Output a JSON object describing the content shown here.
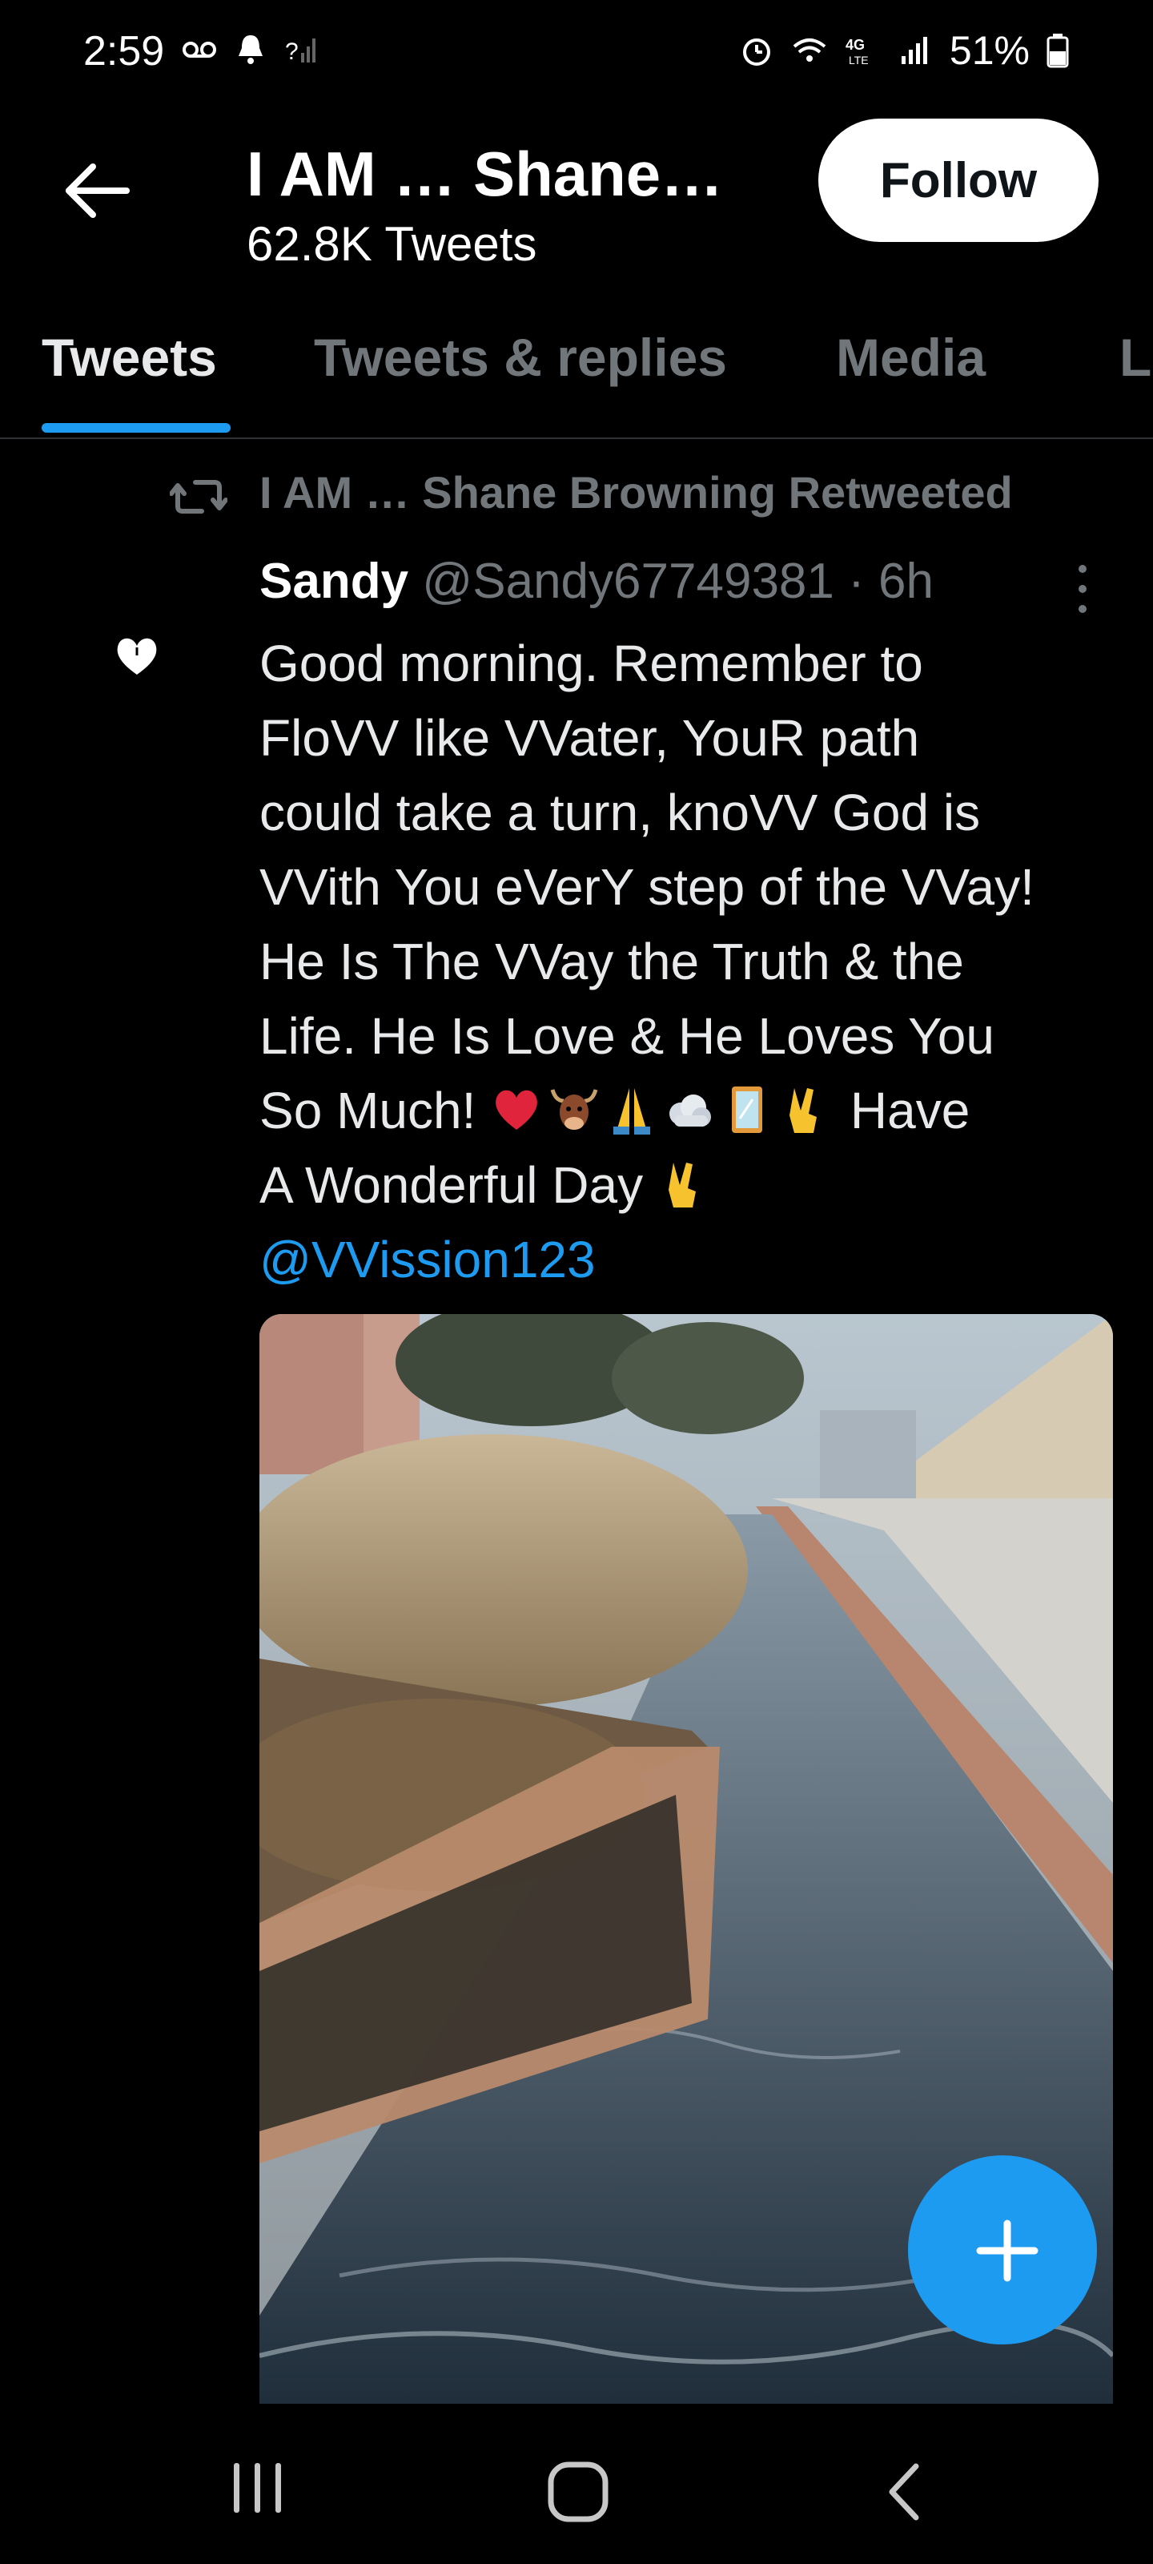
{
  "status_bar": {
    "time": "2:59",
    "battery": "51%"
  },
  "header": {
    "title": "I AM … Shane…",
    "subtitle": "62.8K Tweets",
    "follow_label": "Follow"
  },
  "tabs": [
    {
      "label": "Tweets",
      "active": true
    },
    {
      "label": "Tweets & replies",
      "active": false
    },
    {
      "label": "Media",
      "active": false
    },
    {
      "label": "L",
      "active": false
    }
  ],
  "tweet": {
    "retweet_label": "I AM … Shane Browning Retweeted",
    "author_name": "Sandy",
    "handle": "@Sandy67749381",
    "time": "· 6h",
    "lines": [
      "Good morning. Remember to",
      "FloVV like VVater, YouR path",
      "could take a turn, knoVV God is",
      "VVith You eVerY step of the VVay!",
      "He Is The VVay the Truth & the",
      "Life. He Is Love & He Loves You"
    ],
    "line7_start": "So Much!",
    "line7_end": "Have",
    "line8": "A Wonderful Day",
    "mention": "@VVission123"
  },
  "icons": {
    "back": "arrow-left-icon",
    "retweet": "retweet-icon",
    "more": "more-vertical-icon",
    "fab": "plus-icon",
    "emojis": [
      "red-heart",
      "ox-face",
      "folded-hands",
      "cloud",
      "mirror",
      "victory-hand"
    ]
  },
  "colors": {
    "accent": "#1d9bf0",
    "background": "#000000",
    "muted": "#71767b"
  }
}
